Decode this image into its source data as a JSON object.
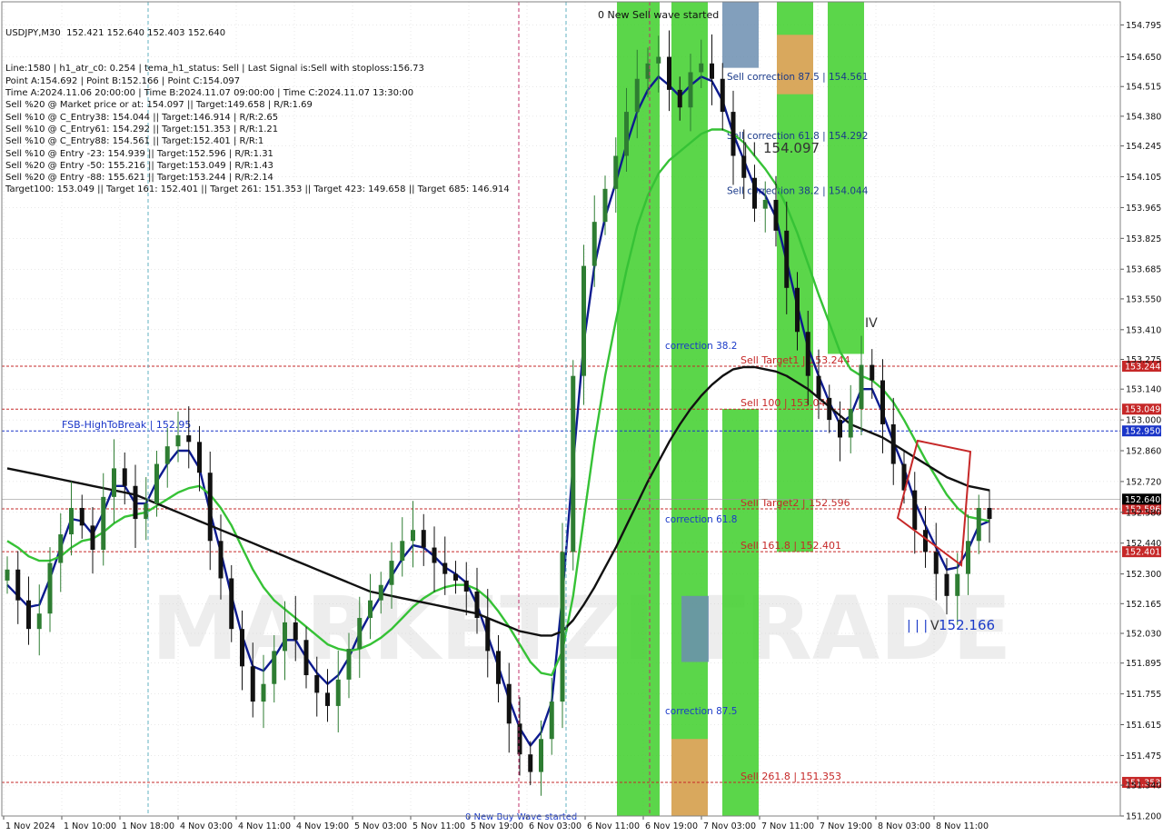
{
  "header": {
    "symbol_line": "USDJPY,M30  152.421 152.640 152.403 152.640",
    "info_lines": [
      "Line:1580 | h1_atr_c0: 0.254 | tema_h1_status: Sell | Last Signal is:Sell with stoploss:156.73",
      "Point A:154.692 | Point B:152.166 | Point C:154.097",
      "Time A:2024.11.06 20:00:00 | Time B:2024.11.07 09:00:00 | Time C:2024.11.07 13:30:00",
      "Sell %20 @ Market price or at: 154.097 || Target:149.658 | R/R:1.69",
      "Sell %10 @ C_Entry38: 154.044 || Target:146.914 | R/R:2.65",
      "Sell %10 @ C_Entry61: 154.292 || Target:151.353 | R/R:1.21",
      "Sell %10 @ C_Entry88: 154.561 || Target:152.401 | R/R:1",
      "Sell %10 @ Entry -23: 154.939 || Target:152.596 | R/R:1.31",
      "Sell %20 @ Entry -50: 155.216 || Target:153.049 | R/R:1.43",
      "Sell %20 @ Entry -88: 155.621 || Target:153.244 | R/R:2.14",
      "Target100: 153.049 || Target 161: 152.401 || Target 261: 151.353 || Target 423: 149.658 || Target 685: 146.914"
    ]
  },
  "chart_data": {
    "type": "candlestick",
    "symbol": "USDJPY",
    "timeframe": "M30",
    "ylim": [
      151.2,
      154.9
    ],
    "y_ticks": [
      "154.795",
      "154.650",
      "154.515",
      "154.380",
      "154.245",
      "154.105",
      "153.965",
      "153.825",
      "153.685",
      "153.550",
      "153.410",
      "153.275",
      "153.140",
      "153.000",
      "152.860",
      "152.720",
      "152.580",
      "152.440",
      "152.300",
      "152.165",
      "152.030",
      "151.895",
      "151.755",
      "151.615",
      "151.475",
      "151.340",
      "151.200"
    ],
    "x_ticks": [
      "1 Nov 2024",
      "1 Nov 10:00",
      "1 Nov 18:00",
      "4 Nov 03:00",
      "4 Nov 11:00",
      "4 Nov 19:00",
      "5 Nov 03:00",
      "5 Nov 11:00",
      "5 Nov 19:00",
      "6 Nov 03:00",
      "6 Nov 11:00",
      "6 Nov 19:00",
      "7 Nov 03:00",
      "7 Nov 11:00",
      "7 Nov 19:00",
      "8 Nov 03:00",
      "8 Nov 11:00"
    ],
    "current_price": "152.640",
    "level_lines": [
      {
        "price": 153.244,
        "label": "Sell Target1 | 153.244",
        "tag": "153.244",
        "color": "#c62828"
      },
      {
        "price": 153.049,
        "label": "Sell 100 | 153.049",
        "tag": "153.049",
        "color": "#c62828"
      },
      {
        "price": 152.95,
        "label": "FSB-HighToBreak | 152.95",
        "tag": "152.950",
        "color": "#1a35c8"
      },
      {
        "price": 152.596,
        "label": "Sell Target2 | 152.596",
        "tag": "152.596",
        "color": "#c62828"
      },
      {
        "price": 152.401,
        "label": "Sell 161.8 | 152.401",
        "tag": "152.401",
        "color": "#c62828"
      },
      {
        "price": 151.353,
        "label": "Sell 261.8 | 151.353",
        "tag": "151.353",
        "color": "#c62828"
      }
    ],
    "zone_labels": [
      {
        "text": "Sell correction 87.5 | 154.561",
        "price": 154.561
      },
      {
        "text": "Sell correction 61.8 | 154.292",
        "price": 154.292
      },
      {
        "text": "Sell correction 38.2 | 154.044",
        "price": 154.044
      },
      {
        "text": "correction 38.2",
        "price": 153.34
      },
      {
        "text": "correction 61.8",
        "price": 152.55
      },
      {
        "text": "correction 87.5",
        "price": 151.68
      }
    ],
    "wave_labels": {
      "sell_wave": "0 New Sell wave started",
      "buy_wave": "0 New Buy Wave started",
      "point_c": "154.097",
      "point_b": "152.166",
      "c_marks": "| |",
      "b_marks": "| | |",
      "wave_iv": "IV",
      "wave_v": "V"
    },
    "series": [
      {
        "name": "close",
        "values": [
          152.32,
          152.18,
          152.05,
          152.12,
          152.35,
          152.48,
          152.6,
          152.52,
          152.41,
          152.65,
          152.78,
          152.7,
          152.55,
          152.62,
          152.8,
          152.88,
          152.93,
          152.9,
          152.76,
          152.45,
          152.28,
          152.05,
          151.88,
          151.72,
          151.8,
          151.95,
          152.08,
          152.0,
          151.84,
          151.76,
          151.7,
          151.82,
          151.96,
          152.1,
          152.18,
          152.25,
          152.36,
          152.45,
          152.5,
          152.42,
          152.35,
          152.3,
          152.27,
          152.22,
          152.1,
          151.95,
          151.8,
          151.62,
          151.48,
          151.4,
          151.55,
          151.72,
          152.4,
          153.2,
          153.7,
          153.9,
          154.05,
          154.2,
          154.4,
          154.55,
          154.62,
          154.65,
          154.5,
          154.42,
          154.58,
          154.62,
          154.55,
          154.4,
          154.2,
          154.1,
          153.96,
          154.0,
          153.86,
          153.6,
          153.4,
          153.2,
          153.1,
          153.0,
          152.92,
          153.05,
          153.25,
          153.18,
          152.98,
          152.8,
          152.68,
          152.5,
          152.4,
          152.3,
          152.2,
          152.3,
          152.45,
          152.6,
          152.55
        ]
      },
      {
        "name": "tema_fast",
        "values": [
          152.25,
          152.2,
          152.15,
          152.16,
          152.28,
          152.42,
          152.55,
          152.54,
          152.48,
          152.58,
          152.7,
          152.7,
          152.62,
          152.62,
          152.72,
          152.8,
          152.86,
          152.86,
          152.78,
          152.58,
          152.4,
          152.2,
          152.02,
          151.88,
          151.86,
          151.92,
          152.0,
          152.0,
          151.92,
          151.85,
          151.8,
          151.84,
          151.92,
          152.03,
          152.12,
          152.2,
          152.29,
          152.37,
          152.43,
          152.42,
          152.38,
          152.33,
          152.3,
          152.26,
          152.16,
          152.02,
          151.88,
          151.73,
          151.6,
          151.52,
          151.58,
          151.72,
          152.2,
          152.8,
          153.35,
          153.7,
          153.92,
          154.08,
          154.25,
          154.4,
          154.5,
          154.56,
          154.52,
          154.47,
          154.52,
          154.56,
          154.54,
          154.45,
          154.3,
          154.18,
          154.06,
          154.02,
          153.92,
          153.72,
          153.52,
          153.33,
          153.2,
          153.08,
          152.98,
          153.02,
          153.14,
          153.14,
          153.03,
          152.9,
          152.78,
          152.63,
          152.52,
          152.42,
          152.32,
          152.33,
          152.41,
          152.52,
          152.54
        ]
      },
      {
        "name": "ma_medium",
        "values": [
          152.45,
          152.42,
          152.38,
          152.36,
          152.36,
          152.38,
          152.42,
          152.45,
          152.46,
          152.49,
          152.53,
          152.56,
          152.57,
          152.58,
          152.61,
          152.64,
          152.67,
          152.69,
          152.7,
          152.66,
          152.6,
          152.52,
          152.42,
          152.32,
          152.24,
          152.18,
          152.14,
          152.1,
          152.06,
          152.02,
          151.98,
          151.96,
          151.95,
          151.96,
          151.98,
          152.01,
          152.05,
          152.1,
          152.15,
          152.19,
          152.22,
          152.24,
          152.25,
          152.25,
          152.23,
          152.19,
          152.13,
          152.06,
          151.98,
          151.9,
          151.85,
          151.84,
          151.95,
          152.2,
          152.55,
          152.9,
          153.2,
          153.45,
          153.68,
          153.88,
          154.02,
          154.12,
          154.18,
          154.22,
          154.26,
          154.3,
          154.32,
          154.32,
          154.3,
          154.26,
          154.2,
          154.14,
          154.07,
          153.97,
          153.85,
          153.71,
          153.57,
          153.44,
          153.31,
          153.23,
          153.2,
          153.18,
          153.14,
          153.08,
          153.0,
          152.91,
          152.82,
          152.74,
          152.66,
          152.6,
          152.56,
          152.55,
          152.54
        ]
      },
      {
        "name": "ma_slow",
        "values": [
          152.78,
          152.77,
          152.76,
          152.75,
          152.74,
          152.73,
          152.72,
          152.71,
          152.7,
          152.69,
          152.68,
          152.67,
          152.66,
          152.64,
          152.62,
          152.6,
          152.58,
          152.56,
          152.54,
          152.52,
          152.5,
          152.48,
          152.46,
          152.44,
          152.42,
          152.4,
          152.38,
          152.36,
          152.34,
          152.32,
          152.3,
          152.28,
          152.26,
          152.24,
          152.22,
          152.21,
          152.2,
          152.19,
          152.18,
          152.17,
          152.16,
          152.15,
          152.14,
          152.13,
          152.12,
          152.1,
          152.08,
          152.06,
          152.04,
          152.03,
          152.02,
          152.02,
          152.04,
          152.09,
          152.16,
          152.24,
          152.33,
          152.42,
          152.52,
          152.62,
          152.72,
          152.81,
          152.9,
          152.98,
          153.05,
          153.11,
          153.16,
          153.2,
          153.23,
          153.24,
          153.24,
          153.23,
          153.22,
          153.2,
          153.17,
          153.14,
          153.1,
          153.06,
          153.02,
          152.98,
          152.96,
          152.94,
          152.92,
          152.89,
          152.86,
          152.83,
          152.8,
          152.77,
          152.74,
          152.72,
          152.7,
          152.69,
          152.68
        ]
      }
    ]
  },
  "colors": {
    "grid": "#d0d0d0",
    "frame": "#808080",
    "bull_candle": "#2e7d32",
    "bear_candle": "#111111",
    "ma_fast": "#0d1b8f",
    "ma_medium": "#36c236",
    "ma_slow": "#111111",
    "green_zone": "#3ecf2a",
    "orange_zone": "#f0a060",
    "blue_zone": "#6c8eb0",
    "red_line": "#c62828",
    "current_tag": "#000000"
  },
  "watermark": "MARKETZI TRADE"
}
